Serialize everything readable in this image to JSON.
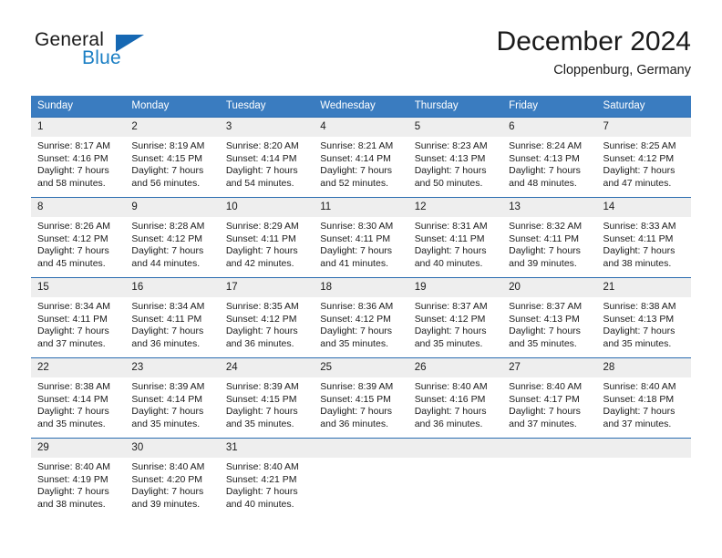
{
  "brand": {
    "word_general": "General",
    "word_blue": "Blue",
    "triangle_color": "#1668b3",
    "blue_color": "#1b7fc4"
  },
  "header": {
    "title": "December 2024",
    "location": "Cloppenburg, Germany"
  },
  "theme": {
    "header_row_bg": "#3a7cc0",
    "cell_top_border": "#2a6cb0",
    "daynum_bg": "#eeeeee",
    "text": "#1a1a1a"
  },
  "weekdays": [
    "Sunday",
    "Monday",
    "Tuesday",
    "Wednesday",
    "Thursday",
    "Friday",
    "Saturday"
  ],
  "weeks": [
    [
      {
        "day": "1",
        "sunrise": "Sunrise: 8:17 AM",
        "sunset": "Sunset: 4:16 PM",
        "daylight_line1": "Daylight: 7 hours",
        "daylight_line2": "and 58 minutes."
      },
      {
        "day": "2",
        "sunrise": "Sunrise: 8:19 AM",
        "sunset": "Sunset: 4:15 PM",
        "daylight_line1": "Daylight: 7 hours",
        "daylight_line2": "and 56 minutes."
      },
      {
        "day": "3",
        "sunrise": "Sunrise: 8:20 AM",
        "sunset": "Sunset: 4:14 PM",
        "daylight_line1": "Daylight: 7 hours",
        "daylight_line2": "and 54 minutes."
      },
      {
        "day": "4",
        "sunrise": "Sunrise: 8:21 AM",
        "sunset": "Sunset: 4:14 PM",
        "daylight_line1": "Daylight: 7 hours",
        "daylight_line2": "and 52 minutes."
      },
      {
        "day": "5",
        "sunrise": "Sunrise: 8:23 AM",
        "sunset": "Sunset: 4:13 PM",
        "daylight_line1": "Daylight: 7 hours",
        "daylight_line2": "and 50 minutes."
      },
      {
        "day": "6",
        "sunrise": "Sunrise: 8:24 AM",
        "sunset": "Sunset: 4:13 PM",
        "daylight_line1": "Daylight: 7 hours",
        "daylight_line2": "and 48 minutes."
      },
      {
        "day": "7",
        "sunrise": "Sunrise: 8:25 AM",
        "sunset": "Sunset: 4:12 PM",
        "daylight_line1": "Daylight: 7 hours",
        "daylight_line2": "and 47 minutes."
      }
    ],
    [
      {
        "day": "8",
        "sunrise": "Sunrise: 8:26 AM",
        "sunset": "Sunset: 4:12 PM",
        "daylight_line1": "Daylight: 7 hours",
        "daylight_line2": "and 45 minutes."
      },
      {
        "day": "9",
        "sunrise": "Sunrise: 8:28 AM",
        "sunset": "Sunset: 4:12 PM",
        "daylight_line1": "Daylight: 7 hours",
        "daylight_line2": "and 44 minutes."
      },
      {
        "day": "10",
        "sunrise": "Sunrise: 8:29 AM",
        "sunset": "Sunset: 4:11 PM",
        "daylight_line1": "Daylight: 7 hours",
        "daylight_line2": "and 42 minutes."
      },
      {
        "day": "11",
        "sunrise": "Sunrise: 8:30 AM",
        "sunset": "Sunset: 4:11 PM",
        "daylight_line1": "Daylight: 7 hours",
        "daylight_line2": "and 41 minutes."
      },
      {
        "day": "12",
        "sunrise": "Sunrise: 8:31 AM",
        "sunset": "Sunset: 4:11 PM",
        "daylight_line1": "Daylight: 7 hours",
        "daylight_line2": "and 40 minutes."
      },
      {
        "day": "13",
        "sunrise": "Sunrise: 8:32 AM",
        "sunset": "Sunset: 4:11 PM",
        "daylight_line1": "Daylight: 7 hours",
        "daylight_line2": "and 39 minutes."
      },
      {
        "day": "14",
        "sunrise": "Sunrise: 8:33 AM",
        "sunset": "Sunset: 4:11 PM",
        "daylight_line1": "Daylight: 7 hours",
        "daylight_line2": "and 38 minutes."
      }
    ],
    [
      {
        "day": "15",
        "sunrise": "Sunrise: 8:34 AM",
        "sunset": "Sunset: 4:11 PM",
        "daylight_line1": "Daylight: 7 hours",
        "daylight_line2": "and 37 minutes."
      },
      {
        "day": "16",
        "sunrise": "Sunrise: 8:34 AM",
        "sunset": "Sunset: 4:11 PM",
        "daylight_line1": "Daylight: 7 hours",
        "daylight_line2": "and 36 minutes."
      },
      {
        "day": "17",
        "sunrise": "Sunrise: 8:35 AM",
        "sunset": "Sunset: 4:12 PM",
        "daylight_line1": "Daylight: 7 hours",
        "daylight_line2": "and 36 minutes."
      },
      {
        "day": "18",
        "sunrise": "Sunrise: 8:36 AM",
        "sunset": "Sunset: 4:12 PM",
        "daylight_line1": "Daylight: 7 hours",
        "daylight_line2": "and 35 minutes."
      },
      {
        "day": "19",
        "sunrise": "Sunrise: 8:37 AM",
        "sunset": "Sunset: 4:12 PM",
        "daylight_line1": "Daylight: 7 hours",
        "daylight_line2": "and 35 minutes."
      },
      {
        "day": "20",
        "sunrise": "Sunrise: 8:37 AM",
        "sunset": "Sunset: 4:13 PM",
        "daylight_line1": "Daylight: 7 hours",
        "daylight_line2": "and 35 minutes."
      },
      {
        "day": "21",
        "sunrise": "Sunrise: 8:38 AM",
        "sunset": "Sunset: 4:13 PM",
        "daylight_line1": "Daylight: 7 hours",
        "daylight_line2": "and 35 minutes."
      }
    ],
    [
      {
        "day": "22",
        "sunrise": "Sunrise: 8:38 AM",
        "sunset": "Sunset: 4:14 PM",
        "daylight_line1": "Daylight: 7 hours",
        "daylight_line2": "and 35 minutes."
      },
      {
        "day": "23",
        "sunrise": "Sunrise: 8:39 AM",
        "sunset": "Sunset: 4:14 PM",
        "daylight_line1": "Daylight: 7 hours",
        "daylight_line2": "and 35 minutes."
      },
      {
        "day": "24",
        "sunrise": "Sunrise: 8:39 AM",
        "sunset": "Sunset: 4:15 PM",
        "daylight_line1": "Daylight: 7 hours",
        "daylight_line2": "and 35 minutes."
      },
      {
        "day": "25",
        "sunrise": "Sunrise: 8:39 AM",
        "sunset": "Sunset: 4:15 PM",
        "daylight_line1": "Daylight: 7 hours",
        "daylight_line2": "and 36 minutes."
      },
      {
        "day": "26",
        "sunrise": "Sunrise: 8:40 AM",
        "sunset": "Sunset: 4:16 PM",
        "daylight_line1": "Daylight: 7 hours",
        "daylight_line2": "and 36 minutes."
      },
      {
        "day": "27",
        "sunrise": "Sunrise: 8:40 AM",
        "sunset": "Sunset: 4:17 PM",
        "daylight_line1": "Daylight: 7 hours",
        "daylight_line2": "and 37 minutes."
      },
      {
        "day": "28",
        "sunrise": "Sunrise: 8:40 AM",
        "sunset": "Sunset: 4:18 PM",
        "daylight_line1": "Daylight: 7 hours",
        "daylight_line2": "and 37 minutes."
      }
    ],
    [
      {
        "day": "29",
        "sunrise": "Sunrise: 8:40 AM",
        "sunset": "Sunset: 4:19 PM",
        "daylight_line1": "Daylight: 7 hours",
        "daylight_line2": "and 38 minutes."
      },
      {
        "day": "30",
        "sunrise": "Sunrise: 8:40 AM",
        "sunset": "Sunset: 4:20 PM",
        "daylight_line1": "Daylight: 7 hours",
        "daylight_line2": "and 39 minutes."
      },
      {
        "day": "31",
        "sunrise": "Sunrise: 8:40 AM",
        "sunset": "Sunset: 4:21 PM",
        "daylight_line1": "Daylight: 7 hours",
        "daylight_line2": "and 40 minutes."
      },
      {
        "day": "",
        "sunrise": "",
        "sunset": "",
        "daylight_line1": "",
        "daylight_line2": ""
      },
      {
        "day": "",
        "sunrise": "",
        "sunset": "",
        "daylight_line1": "",
        "daylight_line2": ""
      },
      {
        "day": "",
        "sunrise": "",
        "sunset": "",
        "daylight_line1": "",
        "daylight_line2": ""
      },
      {
        "day": "",
        "sunrise": "",
        "sunset": "",
        "daylight_line1": "",
        "daylight_line2": ""
      }
    ]
  ]
}
